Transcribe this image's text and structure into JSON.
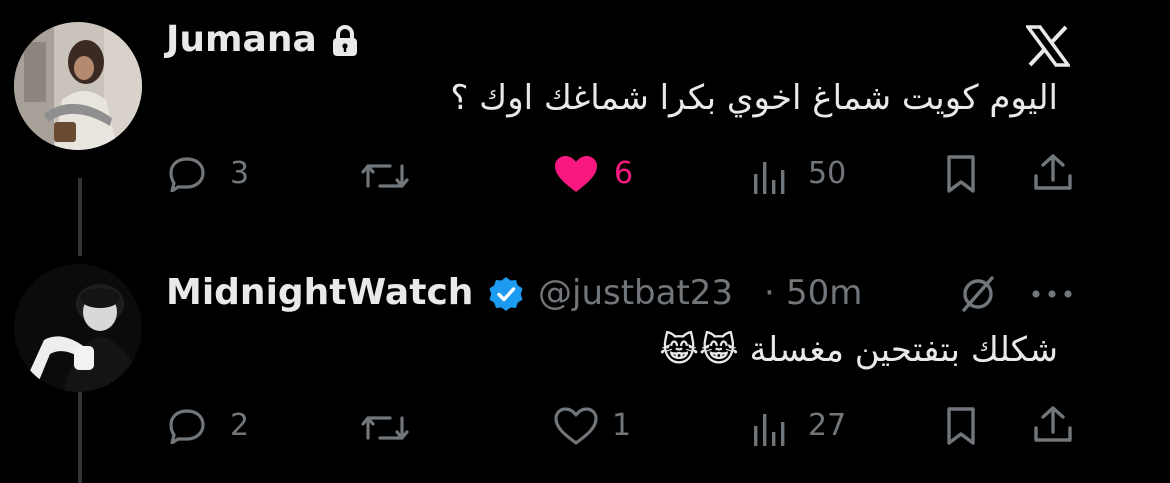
{
  "tweet1": {
    "author_name": "Jumana",
    "protected_icon": "lock-icon",
    "brand_icon": "x-logo-icon",
    "text": "اليوم كويت شماغ اخوي بكرا شماغك اوك ؟",
    "actions": {
      "replies": "3",
      "reposts": "",
      "likes": "6",
      "views": "50"
    },
    "like_color": "#f91880"
  },
  "tweet2": {
    "author_name": "MidnightWatch",
    "verified_icon": "verified-badge-icon",
    "handle": "@justbat23",
    "separator": "·",
    "time": "50m",
    "text": "شكلك بتفتحين مغسلة 😹😹",
    "actions": {
      "replies": "2",
      "reposts": "",
      "likes": "1",
      "views": "27"
    }
  },
  "colors": {
    "background": "#000000",
    "text_primary": "#e7e9ea",
    "text_secondary": "#71767b",
    "verified": "#1d9bf0",
    "thread_line": "#333639"
  }
}
